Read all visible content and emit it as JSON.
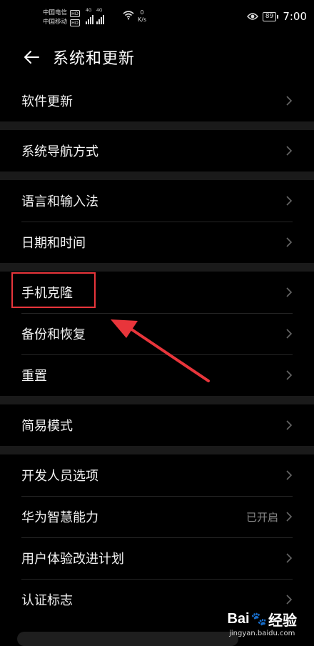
{
  "status_bar": {
    "carrier1": "中国电信",
    "carrier2": "中国移动",
    "hd": "HD",
    "net_type": "4G",
    "speed_value": "0",
    "speed_unit": "K/s",
    "battery": "89",
    "time": "7:00"
  },
  "header": {
    "title": "系统和更新"
  },
  "groups": [
    {
      "items": [
        {
          "label": "软件更新"
        }
      ]
    },
    {
      "items": [
        {
          "label": "系统导航方式"
        }
      ]
    },
    {
      "items": [
        {
          "label": "语言和输入法"
        },
        {
          "label": "日期和时间"
        }
      ]
    },
    {
      "items": [
        {
          "label": "手机克隆"
        },
        {
          "label": "备份和恢复"
        },
        {
          "label": "重置"
        }
      ]
    },
    {
      "items": [
        {
          "label": "简易模式"
        }
      ]
    },
    {
      "items": [
        {
          "label": "开发人员选项"
        },
        {
          "label": "华为智慧能力",
          "status": "已开启"
        },
        {
          "label": "用户体验改进计划"
        },
        {
          "label": "认证标志"
        }
      ]
    }
  ],
  "watermark": {
    "brand": "Bai",
    "suffix": "经验",
    "url": "jingyan.baidu.com"
  },
  "colors": {
    "highlight": "#e8353b",
    "background": "#000000",
    "separator": "#1a1a1a"
  }
}
